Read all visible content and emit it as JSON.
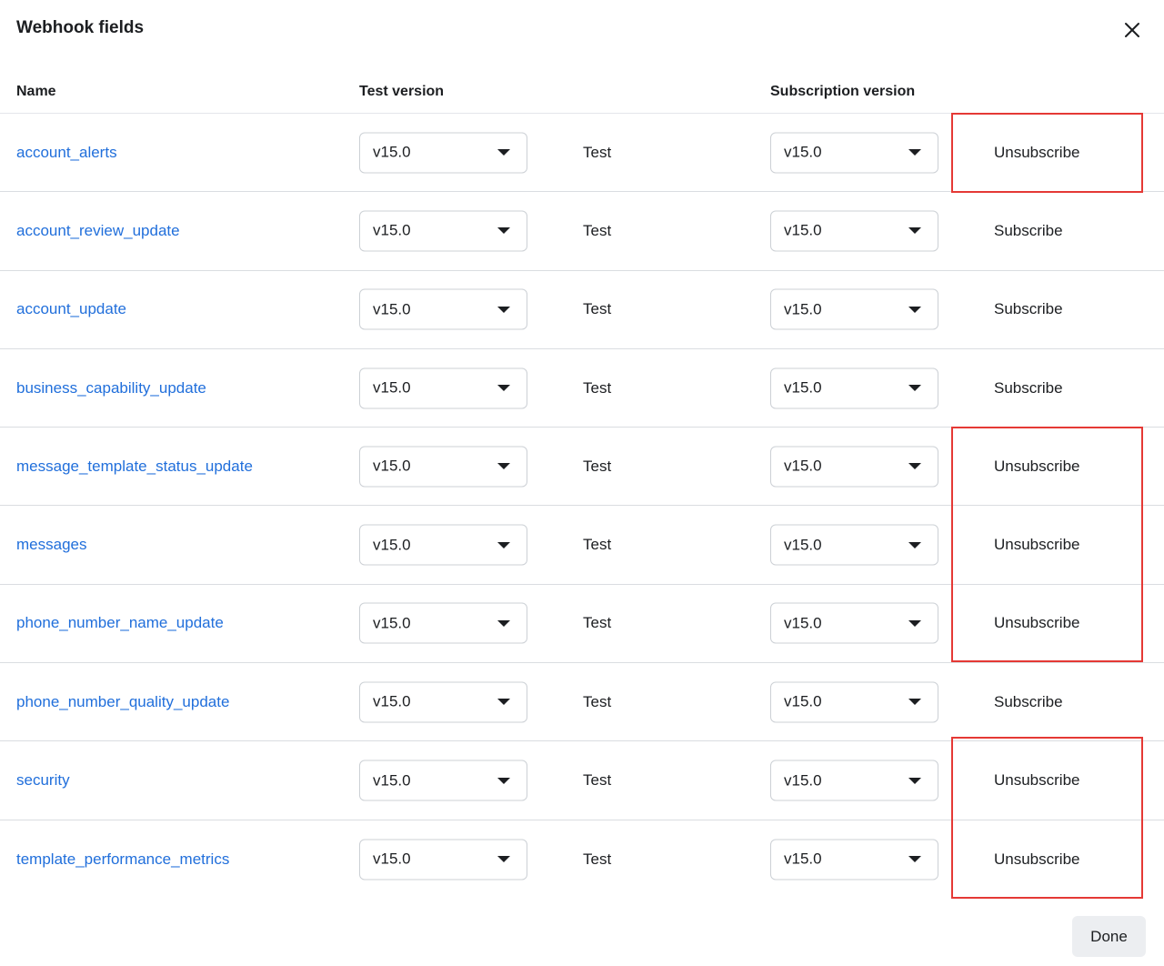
{
  "dialog": {
    "title": "Webhook fields",
    "close_icon": "close-icon",
    "done_label": "Done"
  },
  "table": {
    "headers": {
      "name": "Name",
      "test_version": "Test version",
      "subscription_version": "Subscription version"
    },
    "rows": [
      {
        "name": "account_alerts",
        "test_version": "v15.0",
        "test_label": "Test",
        "subscription_version": "v15.0",
        "action": "Unsubscribe"
      },
      {
        "name": "account_review_update",
        "test_version": "v15.0",
        "test_label": "Test",
        "subscription_version": "v15.0",
        "action": "Subscribe"
      },
      {
        "name": "account_update",
        "test_version": "v15.0",
        "test_label": "Test",
        "subscription_version": "v15.0",
        "action": "Subscribe"
      },
      {
        "name": "business_capability_update",
        "test_version": "v15.0",
        "test_label": "Test",
        "subscription_version": "v15.0",
        "action": "Subscribe"
      },
      {
        "name": "message_template_status_update",
        "test_version": "v15.0",
        "test_label": "Test",
        "subscription_version": "v15.0",
        "action": "Unsubscribe"
      },
      {
        "name": "messages",
        "test_version": "v15.0",
        "test_label": "Test",
        "subscription_version": "v15.0",
        "action": "Unsubscribe"
      },
      {
        "name": "phone_number_name_update",
        "test_version": "v15.0",
        "test_label": "Test",
        "subscription_version": "v15.0",
        "action": "Unsubscribe"
      },
      {
        "name": "phone_number_quality_update",
        "test_version": "v15.0",
        "test_label": "Test",
        "subscription_version": "v15.0",
        "action": "Subscribe"
      },
      {
        "name": "security",
        "test_version": "v15.0",
        "test_label": "Test",
        "subscription_version": "v15.0",
        "action": "Unsubscribe"
      },
      {
        "name": "template_performance_metrics",
        "test_version": "v15.0",
        "test_label": "Test",
        "subscription_version": "v15.0",
        "action": "Unsubscribe"
      }
    ]
  },
  "colors": {
    "link": "#216fdb",
    "highlight": "#e53935",
    "divider": "#dadde1"
  }
}
